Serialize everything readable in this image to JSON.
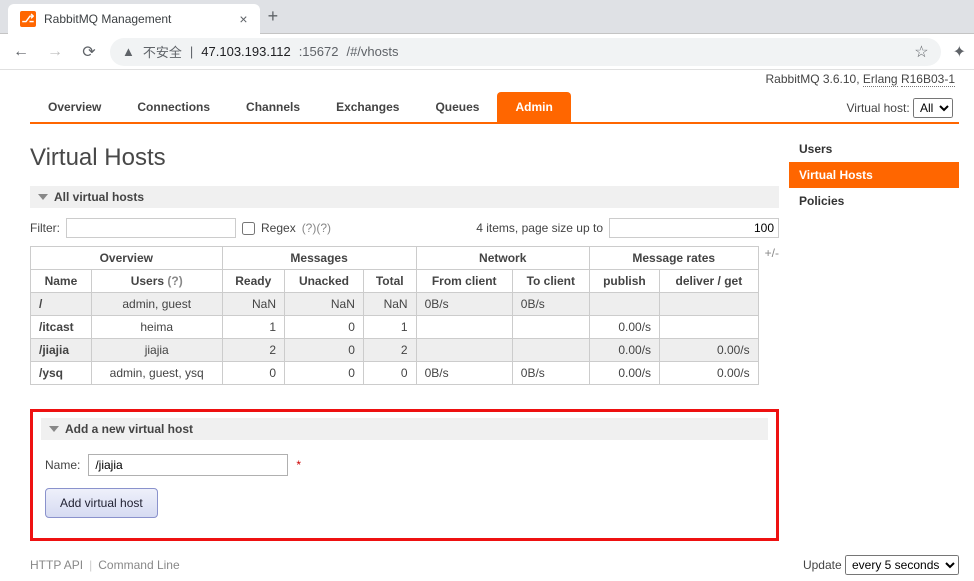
{
  "browser": {
    "tab_title": "RabbitMQ Management",
    "url_warning": "不安全",
    "url_host": "47.103.193.112",
    "url_port": ":15672",
    "url_path": "/#/vhosts"
  },
  "version_line": {
    "product": "RabbitMQ 3.6.10,",
    "erlang": "Erlang",
    "erlang_ver": "R16B03-1"
  },
  "tabs": [
    "Overview",
    "Connections",
    "Channels",
    "Exchanges",
    "Queues",
    "Admin"
  ],
  "active_tab": "Admin",
  "vhost_label": "Virtual host:",
  "vhost_selected": "All",
  "page_title": "Virtual Hosts",
  "sections": {
    "all": "All virtual hosts",
    "add": "Add a new virtual host"
  },
  "filter": {
    "label": "Filter:",
    "value": "",
    "regex_label": "Regex",
    "help": "(?)(?)",
    "items_text": "4 items, page size up to",
    "page_size": "100"
  },
  "table": {
    "group_headers": [
      "Overview",
      "Messages",
      "Network",
      "Message rates"
    ],
    "plusminus": "+/-",
    "headers": [
      "Name",
      "Users",
      "Ready",
      "Unacked",
      "Total",
      "From client",
      "To client",
      "publish",
      "deliver / get"
    ],
    "users_help": "(?)",
    "rows": [
      {
        "name": "/",
        "users": "admin, guest",
        "ready": "NaN",
        "unacked": "NaN",
        "total": "NaN",
        "from_client": "0B/s",
        "to_client": "0B/s",
        "publish": "",
        "deliver": ""
      },
      {
        "name": "/itcast",
        "users": "heima",
        "ready": "1",
        "unacked": "0",
        "total": "1",
        "from_client": "",
        "to_client": "",
        "publish": "0.00/s",
        "deliver": ""
      },
      {
        "name": "/jiajia",
        "users": "jiajia",
        "ready": "2",
        "unacked": "0",
        "total": "2",
        "from_client": "",
        "to_client": "",
        "publish": "0.00/s",
        "deliver": "0.00/s"
      },
      {
        "name": "/ysq",
        "users": "admin, guest, ysq",
        "ready": "0",
        "unacked": "0",
        "total": "0",
        "from_client": "0B/s",
        "to_client": "0B/s",
        "publish": "0.00/s",
        "deliver": "0.00/s"
      }
    ]
  },
  "add_form": {
    "name_label": "Name:",
    "name_value": "/jiajia",
    "required": "*",
    "submit": "Add virtual host"
  },
  "side_nav": [
    "Users",
    "Virtual Hosts",
    "Policies"
  ],
  "side_active": "Virtual Hosts",
  "footer": {
    "http_api": "HTTP API",
    "cmd": "Command Line",
    "update_label": "Update",
    "update_value": "every 5 seconds"
  },
  "watermark": ""
}
